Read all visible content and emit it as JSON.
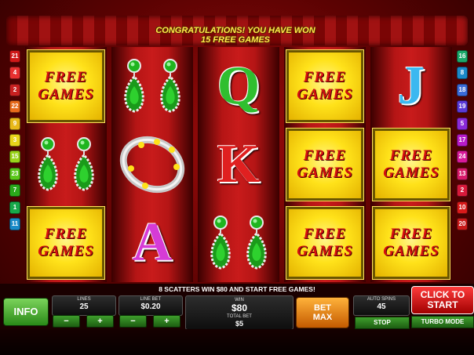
{
  "banner": {
    "line1": "CONGRATULATIONS! YOU HAVE WON",
    "line2": "15 FREE GAMES"
  },
  "payline_numbers": {
    "left": [
      "21",
      "4",
      "2",
      "22",
      "9",
      "3",
      "15",
      "23",
      "7",
      "1",
      "11"
    ],
    "right": [
      "16",
      "8",
      "18",
      "19",
      "5",
      "17",
      "24",
      "13",
      "2",
      "10",
      "20"
    ]
  },
  "reels": [
    [
      "free-games",
      "earrings",
      "free-games"
    ],
    [
      "earrings",
      "ring",
      "letter-a"
    ],
    [
      "letter-q",
      "letter-k",
      "earrings"
    ],
    [
      "free-games",
      "free-games",
      "free-games"
    ],
    [
      "letter-j",
      "free-games",
      "free-games"
    ]
  ],
  "free_games_label": [
    "FREE",
    "GAMES"
  ],
  "letters": {
    "a": "A",
    "q": "Q",
    "k": "K",
    "j": "J"
  },
  "message": "8 SCATTERS WIN $80 AND START FREE GAMES!",
  "controls": {
    "info_label": "INFO",
    "lines_label": "LINES",
    "lines_value": "25",
    "line_bet_label": "LINE BET",
    "line_bet_value": "$0.20",
    "minus": "−",
    "plus": "+",
    "win_label": "WIN",
    "win_value": "$80",
    "total_bet_label": "TOTAL BET",
    "total_bet_value": "$5",
    "bet_max_line1": "BET",
    "bet_max_line2": "MAX",
    "auto_spins_label": "AUTO SPINS",
    "auto_spins_value": "45",
    "stop_label": "STOP",
    "start_line1": "CLICK TO",
    "start_line2": "START",
    "turbo_label": "TURBO MODE"
  },
  "colors": {
    "free_games_text": "#d41010",
    "free_games_bg": "#ffe21a",
    "letter_q": "#2fbf2f",
    "letter_k": "#e02020",
    "letter_a": "#d63bd6",
    "letter_j": "#3bb8f0"
  }
}
